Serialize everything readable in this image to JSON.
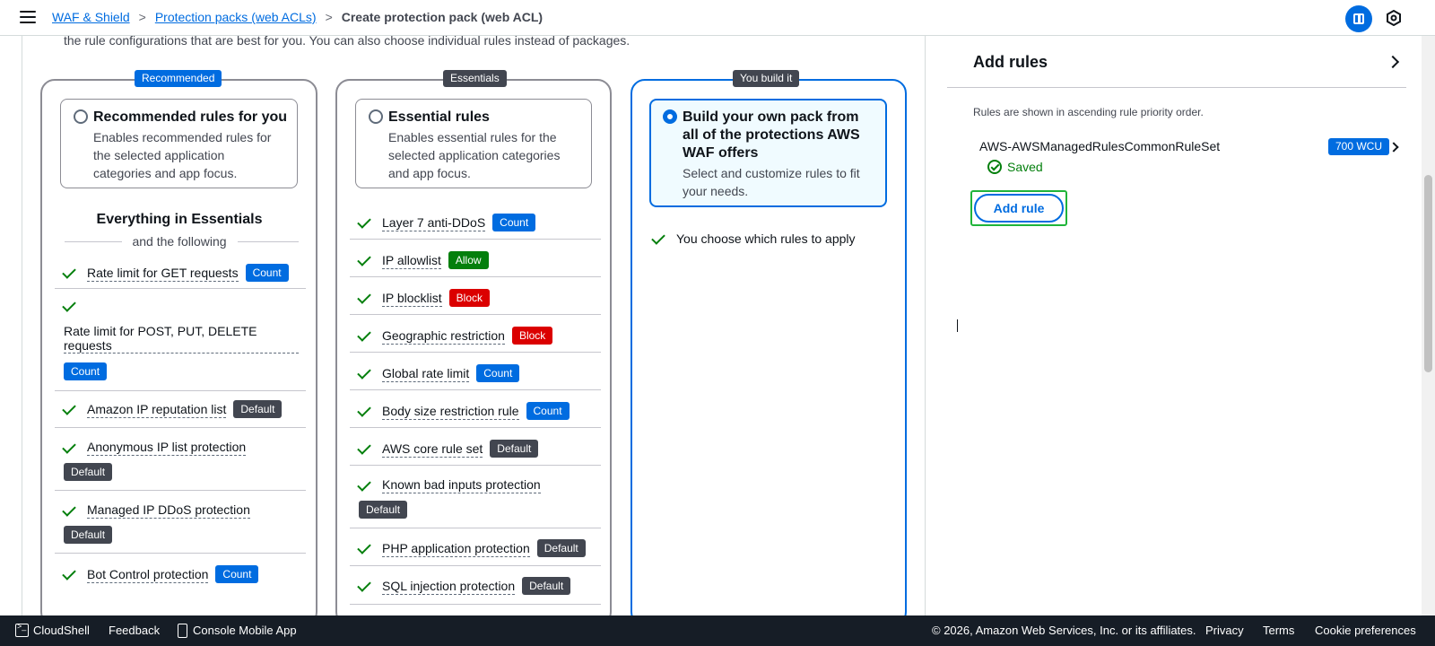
{
  "breadcrumb": {
    "items": [
      "WAF & Shield",
      "Protection packs (web ACLs)"
    ],
    "current": "Create protection pack (web ACL)",
    "separator": ">"
  },
  "intro_text": "the rule configurations that are best for you. You can also choose individual rules instead of packages.",
  "columns": {
    "recommended": {
      "tag": "Recommended",
      "title": "Recommended rules for you",
      "desc": [
        "Enables recommended rules for",
        "the selected application",
        "categories and app focus."
      ],
      "heading": "Everything in Essentials",
      "subheading": "and the following",
      "items": [
        {
          "name": "Rate limit for GET requests",
          "badge": "Count"
        },
        {
          "name": "Rate limit for POST, PUT, DELETE",
          "name2": "requests",
          "badge": "Count"
        },
        {
          "name": "Amazon IP reputation list",
          "badge": "Default"
        },
        {
          "name": "Anonymous IP list protection",
          "badge": "Default"
        },
        {
          "name": "Managed IP DDoS protection",
          "badge": "Default"
        },
        {
          "name": "Bot Control protection",
          "badge": "Count"
        }
      ]
    },
    "essentials": {
      "tag": "Essentials",
      "title": "Essential rules",
      "desc": [
        "Enables essential rules for the",
        "selected application categories",
        "and app focus."
      ],
      "items": [
        {
          "name": "Layer 7 anti-DDoS",
          "badge": "Count"
        },
        {
          "name": "IP allowlist",
          "badge": "Allow"
        },
        {
          "name": "IP blocklist",
          "badge": "Block"
        },
        {
          "name": "Geographic restriction",
          "badge": "Block"
        },
        {
          "name": "Global rate limit",
          "badge": "Count"
        },
        {
          "name": "Body size restriction rule",
          "badge": "Count"
        },
        {
          "name": "AWS core rule set",
          "badge": "Default"
        },
        {
          "name": "Known bad inputs protection",
          "badge": "Default"
        },
        {
          "name": "PHP application protection",
          "badge": "Default"
        },
        {
          "name": "SQL injection protection",
          "badge": "Default"
        }
      ]
    },
    "build": {
      "tag": "You build it",
      "title": [
        "Build your own pack from",
        "all of the protections AWS",
        "WAF offers"
      ],
      "desc": [
        "Select and customize rules to fit",
        "your needs."
      ],
      "items": [
        {
          "name": "You choose which rules to apply"
        }
      ]
    }
  },
  "side_panel": {
    "title": "Add rules",
    "note": "Rules are shown in ascending rule priority order.",
    "rule_name": "AWS-AWSManagedRulesCommonRuleSet",
    "wcu": "700 WCU",
    "status": "Saved",
    "add_button": "Add rule"
  },
  "footer": {
    "cloudshell": "CloudShell",
    "feedback": "Feedback",
    "mobile": "Console Mobile App",
    "copyright": "© 2026, Amazon Web Services, Inc. or its affiliates.",
    "privacy": "Privacy",
    "terms": "Terms",
    "cookies": "Cookie preferences"
  },
  "colors": {
    "accent": "#006ce0",
    "success": "#037f0c",
    "danger": "#db0000",
    "neutral_badge": "#424650",
    "footer_bg": "#161d26"
  }
}
